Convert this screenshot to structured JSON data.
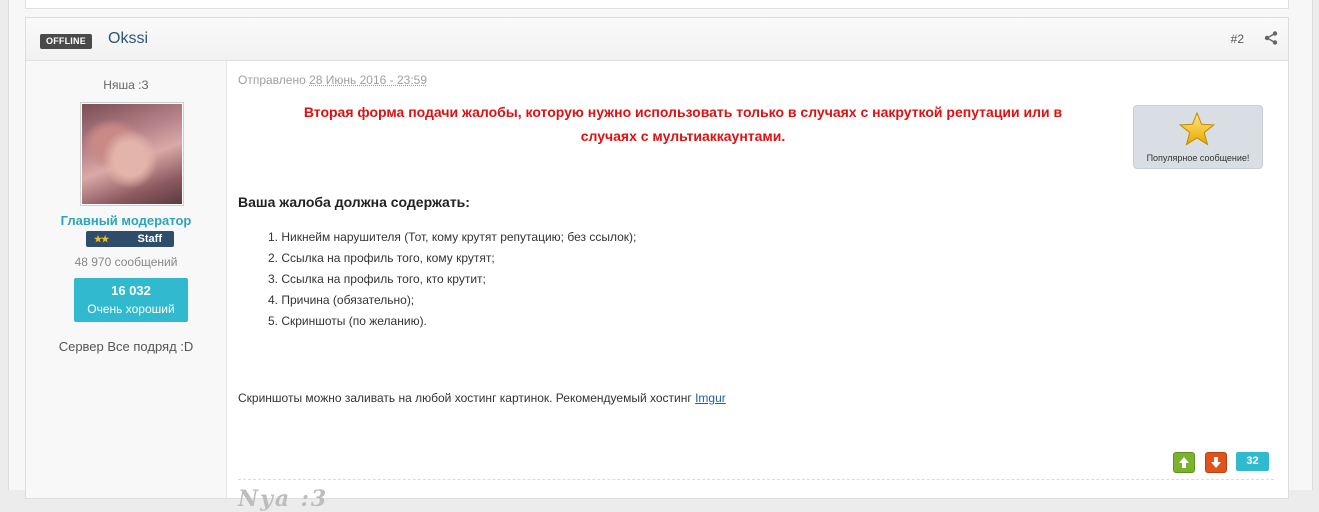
{
  "post": {
    "status_badge": "OFFLINE",
    "author": "Okssi",
    "number": "#2",
    "posted_prefix": "Отправлено",
    "posted_date": "28 Июнь 2016 - 23:59"
  },
  "author_panel": {
    "user_title": "Няша :З",
    "group": "Главный модератор",
    "staff_label": "Staff",
    "staff_stars": "★★",
    "post_count": "48 970 сообщений",
    "reputation_value": "16 032",
    "reputation_label": "Очень хороший",
    "custom_field": "Сервер Все подряд :D"
  },
  "content": {
    "headline_1": "Вторая форма подачи жалобы, которую нужно использовать только в случаях с накруткой репутации или в",
    "headline_2": "случаях с мультиаккаунтами.",
    "popular_badge": "Популярное сообщение!",
    "section_title": "Ваша жалоба должна содержать:",
    "items": [
      "1. Никнейм нарушителя (Тот, кому крутят репутацию; без ссылок);",
      "2. Ссылка на профиль того, кому крутят;",
      "3. Ссылка на профиль того, кто крутит;",
      "4. Причина (обязательно);",
      "5. Скриншоты (по желанию)."
    ],
    "note_text": "Скриншоты можно заливать на любой хостинг картинок. Рекомендуемый хостинг",
    "note_link": "Imgur"
  },
  "votes": {
    "count": "32",
    "up_icon": "arrow-up-icon",
    "down_icon": "arrow-down-icon"
  },
  "signature": {
    "text": "Nya :3"
  },
  "colors": {
    "accent": "#31b9cf",
    "headline": "#e01010",
    "group": "#2aa7b8",
    "vote_up": "#7bb32e",
    "vote_down": "#e0541c"
  }
}
